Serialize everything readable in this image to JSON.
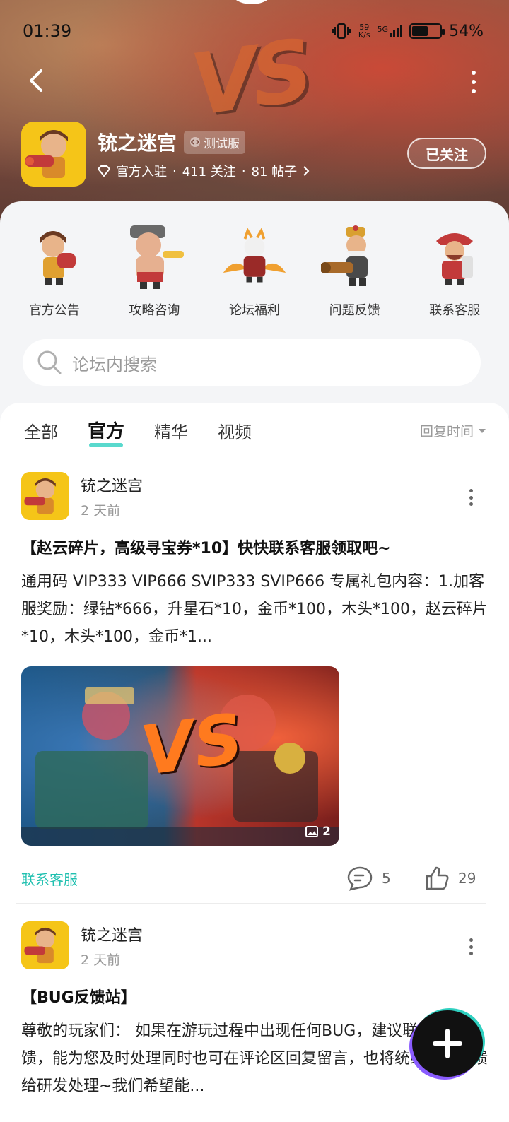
{
  "status_bar": {
    "time": "01:39",
    "net_speed_value": "59",
    "net_speed_unit": "K/s",
    "signal": "5G",
    "battery": "54%",
    "battery_level": 0.54
  },
  "header": {
    "app_name": "铳之迷宫",
    "badge": "测试服",
    "meta_official": "官方入驻",
    "meta_sep": "·",
    "meta_follows": "411 关注",
    "meta_posts": "81 帖子",
    "follow_button": "已关注"
  },
  "quick_links": [
    {
      "label": "官方公告",
      "icon": "gunner-icon"
    },
    {
      "label": "攻略咨询",
      "icon": "strongman-icon"
    },
    {
      "label": "论坛福利",
      "icon": "knight-icon"
    },
    {
      "label": "问题反馈",
      "icon": "cannoneer-icon"
    },
    {
      "label": "联系客服",
      "icon": "general-icon"
    }
  ],
  "search": {
    "placeholder": "论坛内搜索"
  },
  "tabs": [
    {
      "label": "全部",
      "active": false
    },
    {
      "label": "官方",
      "active": true
    },
    {
      "label": "精华",
      "active": false
    },
    {
      "label": "视频",
      "active": false
    }
  ],
  "sort_label": "回复时间",
  "posts": [
    {
      "author": "铳之迷宫",
      "time": "2 天前",
      "title": "【赵云碎片，高级寻宝券*10】快快联系客服领取吧~",
      "body": "通用码 VIP333 VIP666 SVIP333 SVIP666 专属礼包内容：1.加客服奖励：绿钻*666，升星石*10，金币*100，木头*100，赵云碎片*10，木头*100，金币*1...",
      "image_text": "VS",
      "image_count": "2",
      "tag": "联系客服",
      "comments": "5",
      "likes": "29"
    },
    {
      "author": "铳之迷宫",
      "time": "2 天前",
      "title": "【BUG反馈站】",
      "body": "尊敬的玩家们：  如果在游玩过程中出现任何BUG，建议联系客服反馈，能为您及时处理同时也可在评论区回复留言，也将统统收集反馈给研发处理~我们希望能..."
    }
  ],
  "colors": {
    "accent": "#20c0b0",
    "app_icon_bg": "#f5c518"
  }
}
